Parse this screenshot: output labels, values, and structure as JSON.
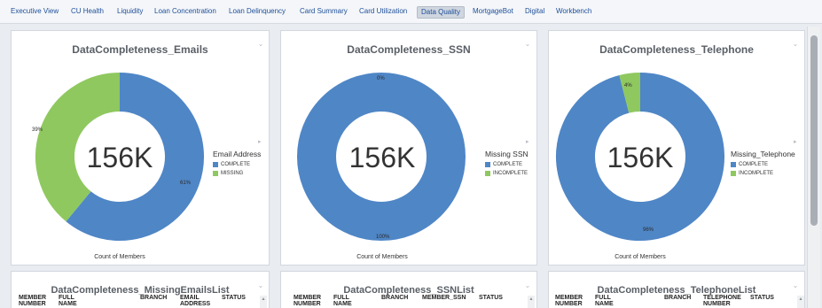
{
  "tabs": [
    {
      "label": "Executive View"
    },
    {
      "label": "CU Health"
    },
    {
      "label": "Liquidity"
    },
    {
      "label": "Loan Concentration"
    },
    {
      "label": "Loan Delinquency"
    },
    {
      "label": "Card Summary"
    },
    {
      "label": "Card Utilization"
    },
    {
      "label": "Data Quality",
      "active": true
    },
    {
      "label": "MortgageBot"
    },
    {
      "label": "Digital"
    },
    {
      "label": "Workbench"
    }
  ],
  "colors": {
    "complete": "#4f86c6",
    "missing": "#8fc85f",
    "tab_active_bg": "#cfd6df"
  },
  "charts": [
    {
      "title": "DataCompleteness_Emails",
      "center_value": "156K",
      "footer": "Count of Members",
      "legend_title": "Email Address",
      "legend_items": [
        "COMPLETE",
        "MISSING"
      ],
      "slice_labels": [
        "61%",
        "39%"
      ]
    },
    {
      "title": "DataCompleteness_SSN",
      "center_value": "156K",
      "footer": "Count of Members",
      "legend_title": "Missing SSN",
      "legend_items": [
        "COMPLETE",
        "INCOMPLETE"
      ],
      "slice_labels": [
        "100%",
        "0%"
      ]
    },
    {
      "title": "DataCompleteness_Telephone",
      "center_value": "156K",
      "footer": "Count of Members",
      "legend_title": "Missing_Telephone",
      "legend_items": [
        "COMPLETE",
        "INCOMPLETE"
      ],
      "slice_labels": [
        "96%",
        "4%"
      ]
    }
  ],
  "chart_data": [
    {
      "type": "pie",
      "title": "DataCompleteness_Emails",
      "categories": [
        "COMPLETE",
        "MISSING"
      ],
      "values": [
        61,
        39
      ],
      "unit": "%",
      "center_label": "156K",
      "legend_position": "right"
    },
    {
      "type": "pie",
      "title": "DataCompleteness_SSN",
      "categories": [
        "COMPLETE",
        "INCOMPLETE"
      ],
      "values": [
        100,
        0
      ],
      "unit": "%",
      "center_label": "156K",
      "legend_position": "right"
    },
    {
      "type": "pie",
      "title": "DataCompleteness_Telephone",
      "categories": [
        "COMPLETE",
        "INCOMPLETE"
      ],
      "values": [
        96,
        4
      ],
      "unit": "%",
      "center_label": "156K",
      "legend_position": "right"
    }
  ],
  "lists": [
    {
      "title": "DataCompleteness_MissingEmailsList",
      "columns": [
        {
          "l1": "MEMBER",
          "l2": "NUMBER"
        },
        {
          "l1": "FULL",
          "l2": "NAME"
        },
        {
          "l1": "",
          "l2": "BRANCH"
        },
        {
          "l1": "EMAIL",
          "l2": "ADDRESS"
        },
        {
          "l1": "",
          "l2": "STATUS"
        }
      ]
    },
    {
      "title": "DataCompleteness_SSNList",
      "columns": [
        {
          "l1": "MEMBER",
          "l2": "NUMBER"
        },
        {
          "l1": "FULL",
          "l2": "NAME"
        },
        {
          "l1": "",
          "l2": "BRANCH"
        },
        {
          "l1": "",
          "l2": "MEMBER_SSN"
        },
        {
          "l1": "",
          "l2": "STATUS"
        }
      ]
    },
    {
      "title": "DataCompleteness_TelephoneList",
      "columns": [
        {
          "l1": "MEMBER",
          "l2": "NUMBER"
        },
        {
          "l1": "FULL",
          "l2": "NAME"
        },
        {
          "l1": "",
          "l2": "BRANCH"
        },
        {
          "l1": "TELEPHONE",
          "l2": "NUMBER"
        },
        {
          "l1": "",
          "l2": "STATUS"
        }
      ]
    }
  ]
}
